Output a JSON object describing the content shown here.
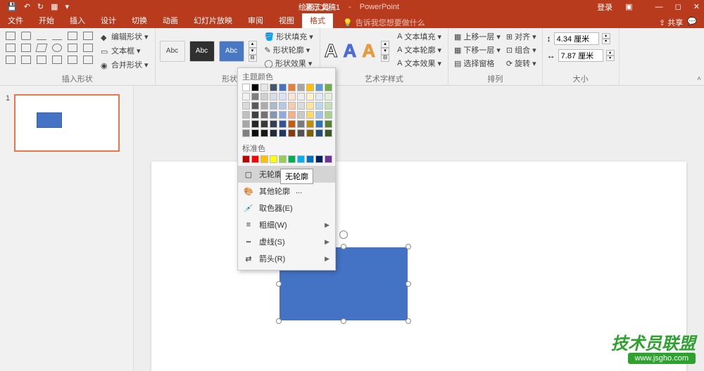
{
  "title": {
    "doc": "演示文稿1",
    "app": "PowerPoint",
    "contextual": "绘图工具"
  },
  "qat_right": {
    "login": "登录",
    "share": "共享"
  },
  "tabs": [
    "文件",
    "开始",
    "插入",
    "设计",
    "切换",
    "动画",
    "幻灯片放映",
    "审阅",
    "视图",
    "格式"
  ],
  "tell_me": "告诉我您想要做什么",
  "group_labels": {
    "insert_shapes": "插入形状",
    "shape_styles": "形状样式",
    "wordart": "艺术字样式",
    "arrange": "排列",
    "size": "大小"
  },
  "shape_tools": {
    "edit": "编辑形状",
    "textbox": "文本框",
    "merge": "合并形状"
  },
  "style_label": "Abc",
  "shape_effects": {
    "fill": "形状填充",
    "outline": "形状轮廓",
    "effects": "形状效果"
  },
  "text_effects": {
    "fill": "文本填充",
    "outline": "文本轮廓",
    "effects": "文本效果"
  },
  "arrange": {
    "bring_fwd": "上移一层",
    "send_back": "下移一层",
    "selection_pane": "选择窗格",
    "align": "对齐",
    "group": "组合",
    "rotate": "旋转"
  },
  "size": {
    "height": "4.34 厘米",
    "width": "7.87 厘米"
  },
  "menu": {
    "theme_colors": "主题颜色",
    "standard_colors": "标准色",
    "no_outline": "无轮廓(N)",
    "more_outline": "其他轮廓",
    "tooltip_nooutline": "无轮廓",
    "eyedropper": "取色器(E)",
    "weight": "粗细(W)",
    "dashes": "虚线(S)",
    "arrows": "箭头(R)"
  },
  "thumb": {
    "num": "1"
  },
  "watermark": {
    "title": "技术员联盟",
    "url": "www.jsgho.com"
  },
  "wa_glyph": "A"
}
